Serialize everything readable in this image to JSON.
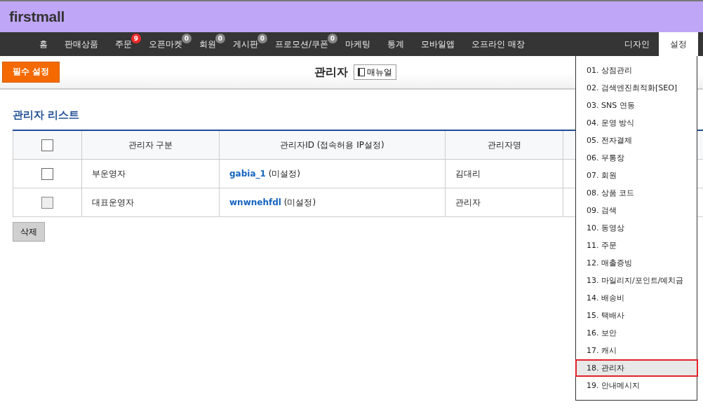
{
  "logo": "firstmall",
  "nav": [
    {
      "label": "홈",
      "selected": false
    },
    {
      "label": "판매상품",
      "selected": false
    },
    {
      "label": "주문",
      "selected": false,
      "badge": "9",
      "color": "#ee2a2a"
    },
    {
      "label": "오픈마켓",
      "selected": false,
      "badge": "0",
      "color": "#888888"
    },
    {
      "label": "회원",
      "selected": false,
      "badge": "0",
      "color": "#888888"
    },
    {
      "label": "게시판",
      "selected": false,
      "badge": "0",
      "color": "#888888"
    },
    {
      "label": "프로모션/쿠폰",
      "selected": false,
      "badge": "0",
      "color": "#888888"
    },
    {
      "label": "마케팅",
      "selected": false
    },
    {
      "label": "통계",
      "selected": false
    },
    {
      "label": "모바일앱",
      "selected": false
    },
    {
      "label": "오프라인 매장",
      "selected": false
    }
  ],
  "nav_right": [
    {
      "label": "디자인",
      "selected": false
    },
    {
      "label": "설정",
      "selected": true
    }
  ],
  "toolbar": {
    "required_button": "필수 설정",
    "title": "관리자",
    "manual_button": "매뉴얼"
  },
  "section_title": "관리자 리스트",
  "table": {
    "header_checkbox": {
      "checked": false,
      "disabled": false
    },
    "columns": [
      "관리자 구분",
      "관리자ID (접속허용 IP설정)",
      "관리자명"
    ],
    "rows": [
      {
        "checked": false,
        "disabled": false,
        "type": "부운영자",
        "id": "gabia_1",
        "ip": "(미설정)",
        "name": "김대리"
      },
      {
        "checked": false,
        "disabled": true,
        "type": "대표운영자",
        "id": "wnwnehfdl",
        "ip": "(미설정)",
        "name": "관리자"
      }
    ]
  },
  "delete_button": "삭제",
  "dropdown": [
    {
      "label": "01. 상점관리",
      "selected": false
    },
    {
      "label": "02. 검색엔진최적화[SEO]",
      "selected": false
    },
    {
      "label": "03. SNS 연동",
      "selected": false
    },
    {
      "label": "04. 운영 방식",
      "selected": false
    },
    {
      "label": "05. 전자결제",
      "selected": false
    },
    {
      "label": "06. 무통장",
      "selected": false
    },
    {
      "label": "07. 회원",
      "selected": false
    },
    {
      "label": "08. 상품 코드",
      "selected": false
    },
    {
      "label": "09. 검색",
      "selected": false
    },
    {
      "label": "10. 동영상",
      "selected": false
    },
    {
      "label": "11. 주문",
      "selected": false
    },
    {
      "label": "12. 매출증빙",
      "selected": false
    },
    {
      "label": "13. 마일리지/포인트/예치금",
      "selected": false
    },
    {
      "label": "14. 배송비",
      "selected": false
    },
    {
      "label": "15. 택배사",
      "selected": false
    },
    {
      "label": "16. 보안",
      "selected": false
    },
    {
      "label": "17. 캐시",
      "selected": false
    },
    {
      "label": "18. 관리자",
      "selected": true
    },
    {
      "label": "19. 안내메시지",
      "selected": false
    }
  ]
}
